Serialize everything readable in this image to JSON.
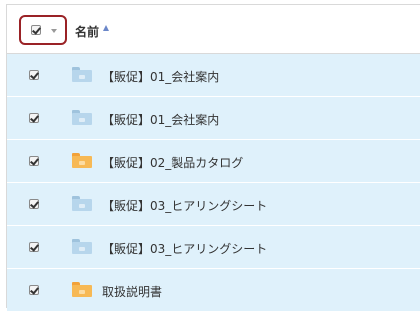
{
  "header": {
    "column_name": "名前",
    "select_all_checked": true,
    "sort_direction": "ascending",
    "sort_icon": "sort-ascending-icon",
    "dropdown_icon": "caret-down-icon",
    "highlight_color": "#9a2226"
  },
  "rows": [
    {
      "name": "【販促】01_会社案内",
      "folder_type": "shared",
      "checked": true
    },
    {
      "name": "【販促】01_会社案内",
      "folder_type": "shared",
      "checked": true
    },
    {
      "name": "【販促】02_製品カタログ",
      "folder_type": "plain",
      "checked": true
    },
    {
      "name": "【販促】03_ヒアリングシート",
      "folder_type": "shared",
      "checked": true
    },
    {
      "name": "【販促】03_ヒアリングシート",
      "folder_type": "shared",
      "checked": true
    },
    {
      "name": "取扱説明書",
      "folder_type": "plain",
      "checked": true
    }
  ],
  "colors": {
    "selected_row_bg": "#dff1fb",
    "shared_folder": "#b7d6ec",
    "plain_folder": "#f7b955",
    "sort_arrow": "#6b87c9"
  }
}
